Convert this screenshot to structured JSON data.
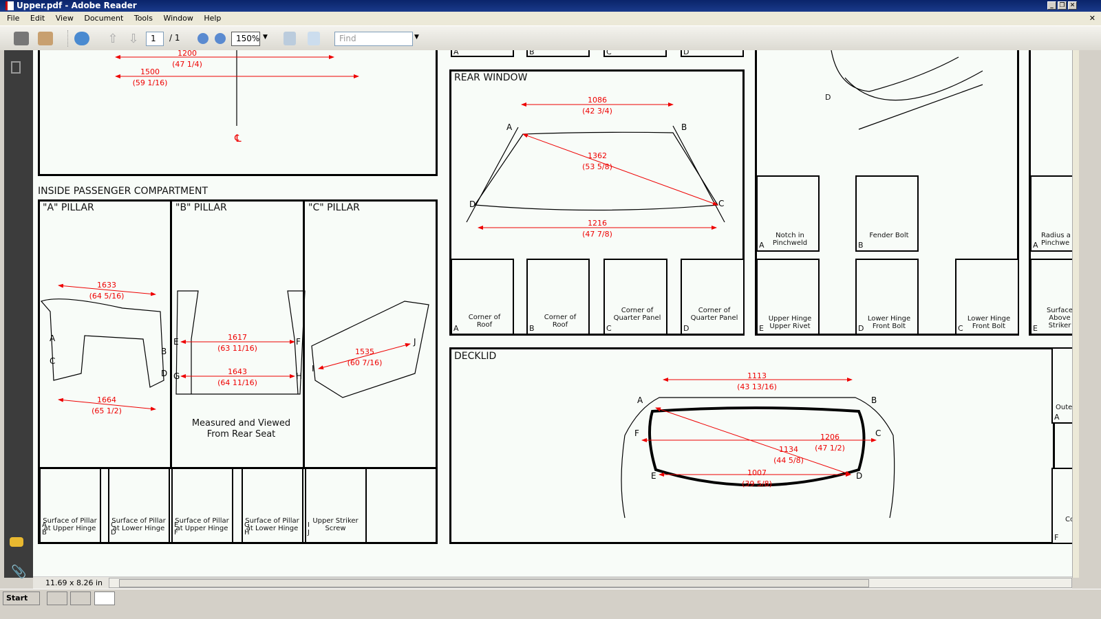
{
  "window": {
    "title": "Upper.pdf - Adobe Reader"
  },
  "menu": [
    "File",
    "Edit",
    "View",
    "Document",
    "Tools",
    "Window",
    "Help"
  ],
  "toolbar": {
    "page_current": "1",
    "page_total": "/ 1",
    "zoom": "150%",
    "find_placeholder": "Find"
  },
  "status": {
    "page_size": "11.69 x 8.26 in"
  },
  "taskbar": {
    "start": "Start"
  },
  "colors": {
    "dimension": "#e00000",
    "titlebar": "#0a246a"
  },
  "doc": {
    "top_left": {
      "dim1": "1200",
      "dim1_in": "(47 1/4)",
      "dim2": "1500",
      "dim2_in": "(59 1/16)",
      "centerline": "℄"
    },
    "inside_title": "INSIDE PASSENGER COMPARTMENT",
    "a_pillar": {
      "title": "\"A\" PILLAR",
      "dim1": "1633",
      "dim1_in": "(64 5/16)",
      "dim2": "1664",
      "dim2_in": "(65 1/2)",
      "pts": [
        "A",
        "B",
        "C",
        "D"
      ]
    },
    "b_pillar": {
      "title": "\"B\" PILLAR",
      "dim1": "1617",
      "dim1_in": "(63 11/16)",
      "dim2": "1643",
      "dim2_in": "(64 11/16)",
      "pts": [
        "E",
        "F",
        "G",
        "H"
      ],
      "note": "Measured and Viewed From Rear Seat"
    },
    "c_pillar": {
      "title": "\"C\" PILLAR",
      "dim1": "1535",
      "dim1_in": "(60 7/16)",
      "pts": [
        "I",
        "J"
      ]
    },
    "pillar_details": [
      {
        "letters": "A\nB",
        "caption": "Surface of Pillar at Upper Hinge"
      },
      {
        "letters": "C\nD",
        "caption": "Surface of Pillar at Lower Hinge"
      },
      {
        "letters": "E\nF",
        "caption": "Surface of Pillar at Upper Hinge"
      },
      {
        "letters": "G\nH",
        "caption": "Surface of Pillar at Lower Hinge"
      },
      {
        "letters": "I\nJ",
        "caption": "Upper Striker Screw"
      }
    ],
    "rear_window": {
      "title": "REAR WINDOW",
      "dim1": "1086",
      "dim1_in": "(42 3/4)",
      "dim2": "1362",
      "dim2_in": "(53 5/8)",
      "dim3": "1216",
      "dim3_in": "(47 7/8)",
      "pts": [
        "A",
        "B",
        "C",
        "D"
      ]
    },
    "rear_details": [
      {
        "letter": "A",
        "caption": "Corner of Roof"
      },
      {
        "letter": "B",
        "caption": "Corner of Roof"
      },
      {
        "letter": "C",
        "caption": "Corner of Quarter Panel"
      },
      {
        "letter": "D",
        "caption": "Corner of Quarter Panel"
      }
    ],
    "top_strip": [
      "A",
      "B",
      "C",
      "D"
    ],
    "hood_point": "D",
    "hood_details": [
      {
        "letter": "A",
        "caption": "Notch in Pinchweld"
      },
      {
        "letter": "B",
        "caption": "Fender Bolt"
      },
      {
        "letter": "E",
        "caption": "Upper Hinge Upper Rivet"
      },
      {
        "letter": "D",
        "caption": "Lower Hinge Front Bolt"
      },
      {
        "letter": "C",
        "caption": "Lower Hinge Front Bolt"
      }
    ],
    "right_partial": [
      {
        "letter": "A",
        "caption": "Radius a Pinchwe"
      },
      {
        "letter": "E",
        "caption": "Surface Above Striker"
      },
      {
        "letter": "A",
        "caption": "Oute Pi"
      },
      {
        "letter": "F",
        "caption": "Co"
      }
    ],
    "decklid": {
      "title": "DECKLID",
      "dim1": "1113",
      "dim1_in": "(43 13/16)",
      "dim2": "1134",
      "dim2_in": "(44 5/8)",
      "dim3": "1206",
      "dim3_in": "(47 1/2)",
      "dim4": "1007",
      "dim4_in": "(39 5/8)",
      "pts": [
        "A",
        "B",
        "C",
        "D",
        "E",
        "F"
      ]
    }
  }
}
